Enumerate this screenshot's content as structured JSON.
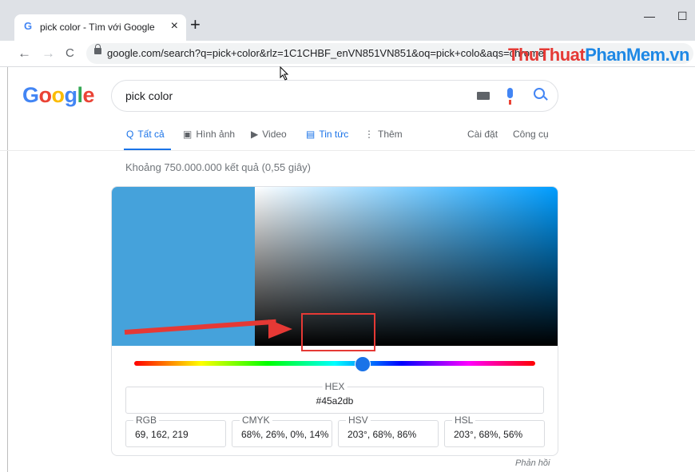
{
  "browser": {
    "tab_title": "pick color - Tìm với Google",
    "tab_favicon": "G",
    "tab_close": "×",
    "new_tab": "+",
    "minimize": "—",
    "maximize": "☐",
    "back": "←",
    "forward": "→",
    "reload": "C",
    "url": "google.com/search?q=pick+color&rlz=1C1CHBF_enVN851VN851&oq=pick+colo&aqs=chrome"
  },
  "watermark": {
    "part1": "ThuThuat",
    "part2": "PhanMem",
    "part3": ".vn"
  },
  "google": {
    "logo": [
      "G",
      "o",
      "o",
      "g",
      "l",
      "e"
    ],
    "logo_colors": [
      "#4285f4",
      "#ea4335",
      "#fbbc05",
      "#4285f4",
      "#34a853",
      "#ea4335"
    ],
    "query": "pick color",
    "tabs": [
      {
        "icon": "Q",
        "label": "Tất cả"
      },
      {
        "icon": "▣",
        "label": "Hình ảnh"
      },
      {
        "icon": "▶",
        "label": "Video"
      },
      {
        "icon": "▤",
        "label": "Tin tức"
      },
      {
        "icon": "⋮",
        "label": "Thêm"
      }
    ],
    "settings": "Cài đặt",
    "tools": "Công cụ",
    "result_stats": "Khoảng 750.000.000 kết quả (0,55 giây)"
  },
  "color_picker": {
    "selected_color": "#45a2db",
    "hex_label": "HEX",
    "hex_value": "#45a2db",
    "rgb_label": "RGB",
    "rgb_value": "69, 162, 219",
    "cmyk_label": "CMYK",
    "cmyk_value": "68%, 26%, 0%, 14%",
    "hsv_label": "HSV",
    "hsv_value": "203°, 68%, 86%",
    "hsl_label": "HSL",
    "hsl_value": "203°, 68%, 56%",
    "hue_degrees": 203
  },
  "feedback": "Phản hồi"
}
